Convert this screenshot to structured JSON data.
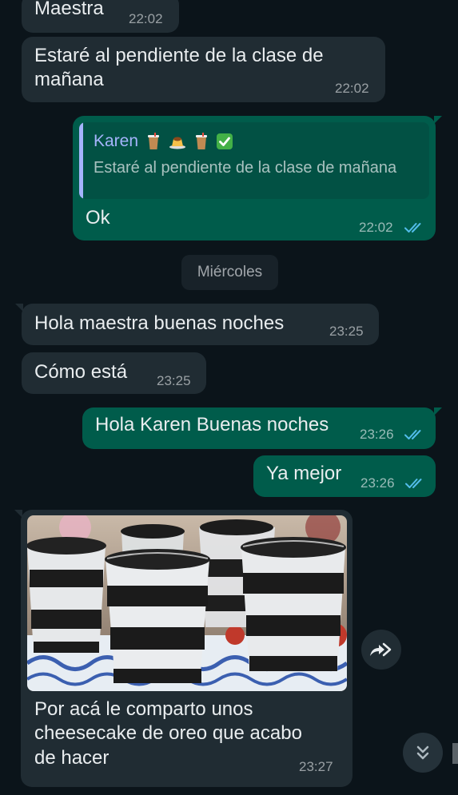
{
  "messages": [
    {
      "id": "m1",
      "text": "Maestra",
      "time": "22:02"
    },
    {
      "id": "m2",
      "line1": "Estaré al pendiente de la clase de",
      "line2": "mañana",
      "time": "22:02"
    },
    {
      "id": "m3",
      "quote_name": "Karen",
      "quote_text": "Estaré al pendiente de la clase de mañana",
      "text": "Ok",
      "time": "22:02"
    },
    {
      "id": "m4",
      "text": "Hola maestra buenas noches",
      "time": "23:25"
    },
    {
      "id": "m5",
      "text": "Cómo está",
      "time": "23:25"
    },
    {
      "id": "m6",
      "text": "Hola Karen Buenas noches",
      "time": "23:26"
    },
    {
      "id": "m7",
      "text": "Ya mejor",
      "time": "23:26"
    },
    {
      "id": "m8",
      "line1": "Por acá le comparto unos",
      "line2": "cheesecake de oreo que acabo",
      "line3": "de hacer",
      "time": "23:27"
    }
  ],
  "date_separator": "Miércoles",
  "colors": {
    "background": "#0b141a",
    "incoming_bubble": "#202c33",
    "outgoing_bubble": "#005c4b",
    "read_ticks": "#53bdeb",
    "quote_accent": "#a5b4fc"
  },
  "icons": {
    "read_receipt": "double-check-icon",
    "forward": "forward-icon",
    "scroll_down": "chevrons-down-icon"
  }
}
